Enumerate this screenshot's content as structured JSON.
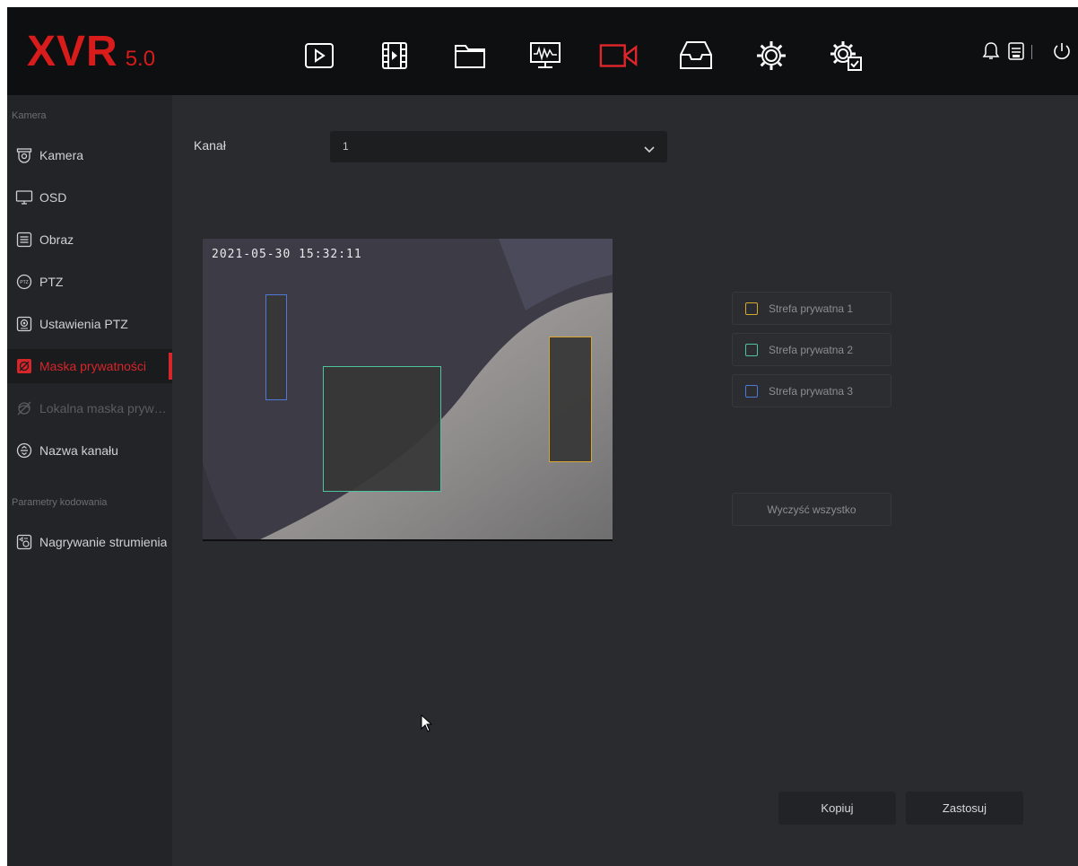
{
  "app": {
    "logo_main": "XVR",
    "logo_version": "5.0"
  },
  "topbar": {
    "icons": [
      "playback-icon",
      "video-clip-icon",
      "folder-icon",
      "monitor-icon",
      "camera-icon",
      "storage-icon",
      "settings-icon",
      "system-settings-icon"
    ],
    "active_icon": "camera-icon",
    "right": [
      "bell-icon",
      "save-icon",
      "power-icon"
    ]
  },
  "sidebar": {
    "section1_title": "Kamera",
    "items1": [
      {
        "label": "Kamera",
        "icon": "camera-dome-icon"
      },
      {
        "label": "OSD",
        "icon": "osd-monitor-icon"
      },
      {
        "label": "Obraz",
        "icon": "image-settings-icon"
      },
      {
        "label": "PTZ",
        "icon": "ptz-icon"
      },
      {
        "label": "Ustawienia PTZ",
        "icon": "ptz-settings-icon"
      },
      {
        "label": "Maska prywatności",
        "icon": "privacy-mask-icon",
        "active": true
      },
      {
        "label": "Lokalna maska prywat...",
        "icon": "local-mask-icon",
        "disabled": true
      },
      {
        "label": "Nazwa kanału",
        "icon": "channel-name-icon"
      }
    ],
    "section2_title": "Parametry kodowania",
    "items2": [
      {
        "label": "Nagrywanie strumienia",
        "icon": "stream-record-icon"
      }
    ]
  },
  "form": {
    "channel_label": "Kanał",
    "channel_value": "1"
  },
  "preview": {
    "timestamp": "2021-05-30 15:32:11",
    "masks": [
      {
        "name": "Strefa prywatna 1",
        "color": "#d9a832"
      },
      {
        "name": "Strefa prywatna 2",
        "color": "#4fc3a0"
      },
      {
        "name": "Strefa prywatna 3",
        "color": "#4f78d9"
      }
    ]
  },
  "zones": [
    {
      "label": "Strefa prywatna 1",
      "color": "#d9a832"
    },
    {
      "label": "Strefa prywatna 2",
      "color": "#4fc3a0"
    },
    {
      "label": "Strefa prywatna 3",
      "color": "#4f78d9"
    }
  ],
  "buttons": {
    "clear_all": "Wyczyść wszystko",
    "copy": "Kopiuj",
    "apply": "Zastosuj"
  },
  "colors": {
    "accent": "#d6262a",
    "background": "#2a2b2e",
    "topbar": "#0e0f10"
  }
}
